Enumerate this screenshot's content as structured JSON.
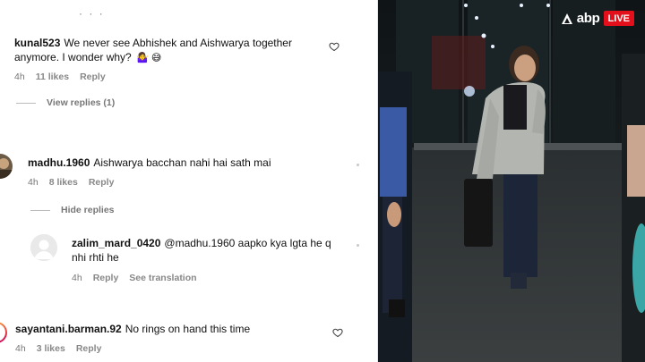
{
  "comments": [
    {
      "username": "kunal523",
      "text": "We never see Abhishek and Aishwarya together anymore. I wonder why?",
      "emojis": "🤷‍♀️ 😅",
      "time": "4h",
      "likes": "11 likes",
      "reply": "Reply"
    },
    {
      "username": "madhu.1960",
      "text": "Aishwarya bacchan nahi hai sath mai",
      "time": "4h",
      "likes": "8 likes",
      "reply": "Reply"
    },
    {
      "username": "sayantani.barman.92",
      "text": "No rings on hand this time",
      "time": "4h",
      "likes": "3 likes",
      "reply": "Reply"
    }
  ],
  "view_replies": "View replies (1)",
  "hide_replies": "Hide replies",
  "reply_comment": {
    "username": "zalim_mard_0420",
    "text": "@madhu.1960 aapko kya lgta he q nhi rhti he",
    "time": "4h",
    "reply": "Reply",
    "translate": "See translation"
  },
  "brand": {
    "name": "abp",
    "live": "LIVE",
    "accent": "#e3101b"
  },
  "icons": [
    "heart-icon",
    "ellipsis-icon",
    "abp-logo-icon"
  ]
}
